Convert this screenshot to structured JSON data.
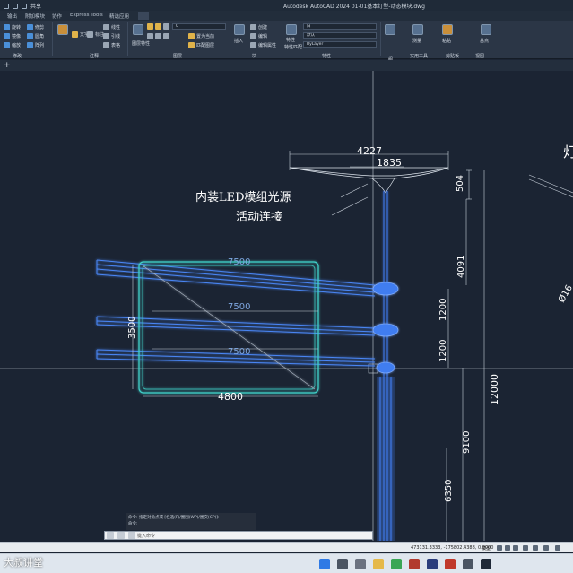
{
  "window": {
    "title": "Autodesk AutoCAD 2024    01-01基本灯型-动态模块.dwg",
    "share_label": "共享"
  },
  "menu_tabs": [
    "输出",
    "附加模块",
    "协作",
    "Express Tools",
    "精选应用"
  ],
  "ribbon": {
    "modify": [
      "移动",
      "旋转",
      "修剪",
      "复制",
      "镜像",
      "圆角",
      "拉伸",
      "缩放",
      "阵列"
    ],
    "annotation": [
      "文字",
      "标注",
      "线性",
      "引线",
      "表格"
    ],
    "layer_value": "0",
    "layer_tools": [
      "图层特性",
      "置为当前",
      "匹配图层"
    ],
    "block": [
      "插入",
      "创建",
      "编辑",
      "编辑属性"
    ],
    "properties": [
      "特性",
      "特性匹配",
      "白",
      "默认",
      "ByLayer"
    ],
    "group_label": "组",
    "utilities_label": "测量",
    "clipboard_label": "粘贴",
    "base_label": "基点",
    "panel_labels": [
      "修改",
      "注释",
      "图层",
      "块",
      "特性",
      "组",
      "实用工具",
      "剪贴板",
      "视图"
    ]
  },
  "drawing": {
    "dims": {
      "top_width": "4227",
      "top_inner": "1835",
      "head_height": "504",
      "upper_span": "4091",
      "sign_width_top": "7500",
      "arm_mid": "7500",
      "arm_low": "7500",
      "sign_height": "3500",
      "sign_width": "4800",
      "gap1": "1200",
      "gap2": "1200",
      "total_height": "12000",
      "lower_height": "9100",
      "base_height": "6350",
      "diameter_partial": "Ø16"
    },
    "annotations": {
      "led_note": "内装LED模组光源",
      "joint_note": "活动连接",
      "edge_char": "灯"
    }
  },
  "command": {
    "history_line": "命令: 指定对角点或 [栏选(F)/圈围(WP)/圈交(CP)]:",
    "history_line2": "命令:",
    "prompt": "键入命令"
  },
  "status": {
    "coords": "473131.3333, -175802.4388, 0.0000",
    "space": "模型"
  },
  "watermark": "大叔讲堂",
  "colors": {
    "background": "#1b2433",
    "geometry": "#3f7df0",
    "geometry_glow": "#7fb0ff",
    "text": "#ffffff"
  }
}
